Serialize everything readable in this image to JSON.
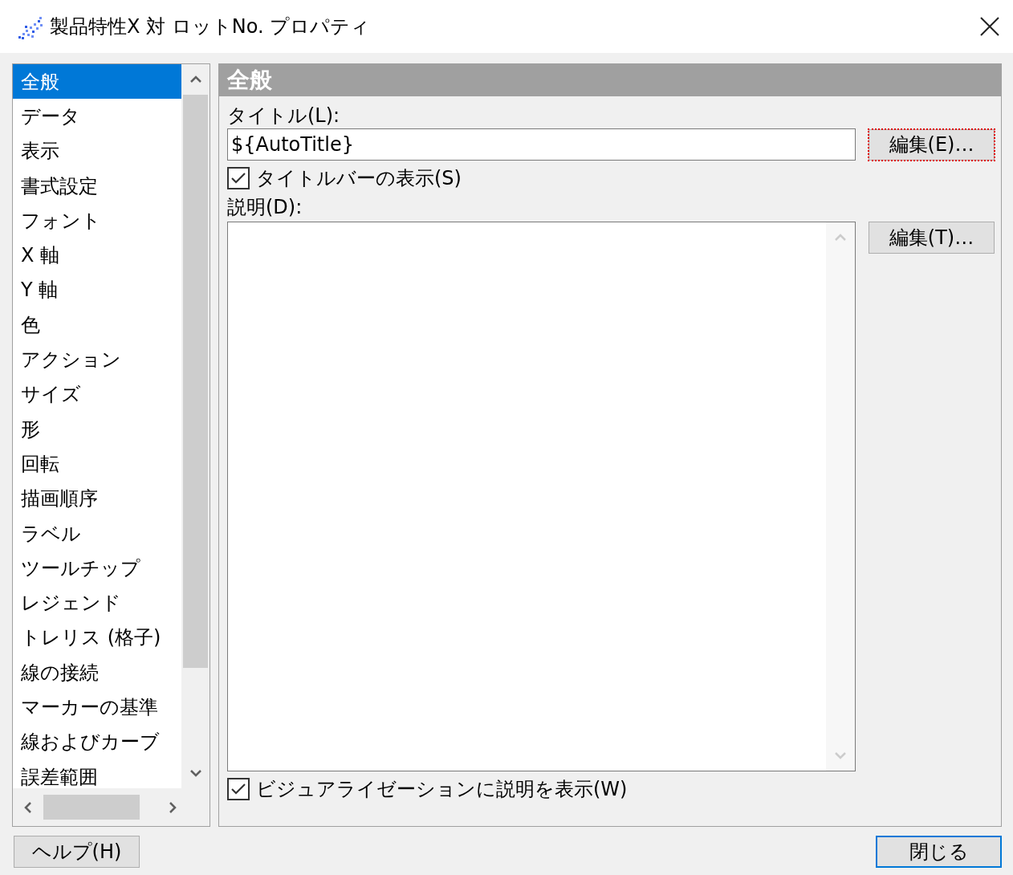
{
  "window": {
    "title": "製品特性X 対 ロットNo. プロパティ"
  },
  "sidebar": {
    "items": [
      {
        "label": "全般",
        "selected": true
      },
      {
        "label": "データ",
        "selected": false
      },
      {
        "label": "表示",
        "selected": false
      },
      {
        "label": "書式設定",
        "selected": false
      },
      {
        "label": "フォント",
        "selected": false
      },
      {
        "label": "X 軸",
        "selected": false
      },
      {
        "label": "Y 軸",
        "selected": false
      },
      {
        "label": "色",
        "selected": false
      },
      {
        "label": "アクション",
        "selected": false
      },
      {
        "label": "サイズ",
        "selected": false
      },
      {
        "label": "形",
        "selected": false
      },
      {
        "label": "回転",
        "selected": false
      },
      {
        "label": "描画順序",
        "selected": false
      },
      {
        "label": "ラベル",
        "selected": false
      },
      {
        "label": "ツールチップ",
        "selected": false
      },
      {
        "label": "レジェンド",
        "selected": false
      },
      {
        "label": "トレリス (格子)",
        "selected": false
      },
      {
        "label": "線の接続",
        "selected": false
      },
      {
        "label": "マーカーの基準",
        "selected": false
      },
      {
        "label": "線およびカーブ",
        "selected": false
      },
      {
        "label": "誤差範囲",
        "selected": false
      }
    ]
  },
  "panel": {
    "heading": "全般",
    "title_label": "タイトル(L):",
    "title_value": "${AutoTitle}",
    "title_edit_button": {
      "label": "編集(E)…",
      "focused": true
    },
    "show_titlebar": {
      "label": "タイトルバーの表示(S)",
      "checked": true
    },
    "description_label": "説明(D):",
    "description_edit_button": {
      "label": "編集(T)…",
      "focused": false
    },
    "show_description": {
      "label": "ビジュアライゼーションに説明を表示(W)",
      "checked": true
    }
  },
  "footer": {
    "help_button": {
      "label": "ヘルプ(H)",
      "default": false
    },
    "close_button": {
      "label": "閉じる",
      "default": true
    }
  }
}
